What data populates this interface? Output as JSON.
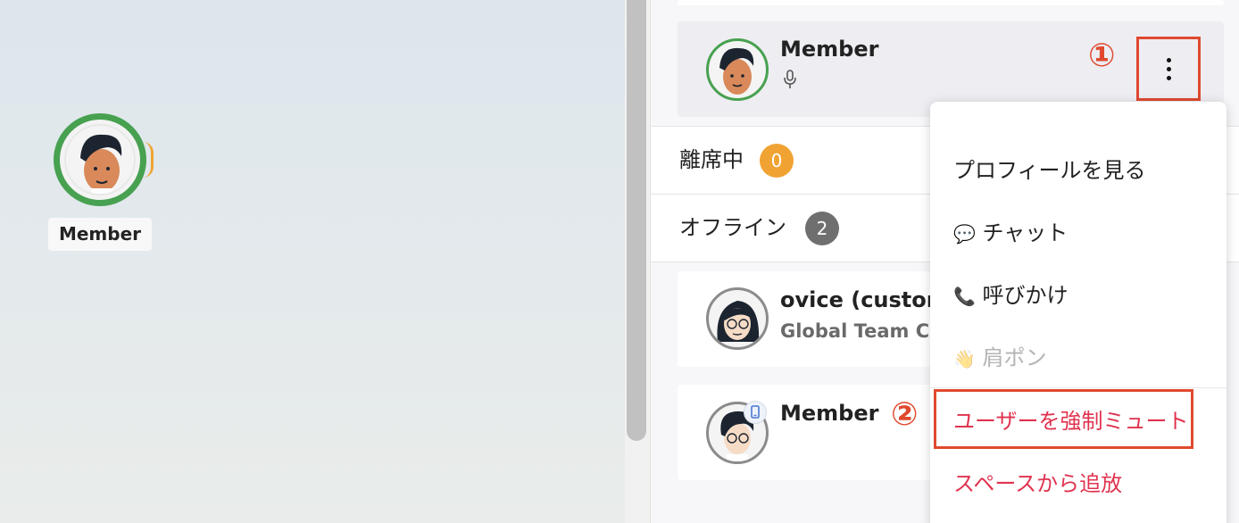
{
  "canvas": {
    "avatar_label": "Member"
  },
  "panel": {
    "active_member": {
      "name": "Member",
      "mic_icon": "microphone-icon"
    },
    "away_section": {
      "label": "離席中",
      "count": "0",
      "badge_color": "#f0a332"
    },
    "offline_section": {
      "label": "オフライン",
      "count": "2",
      "badge_color": "#6f6f6f"
    },
    "offline_members": [
      {
        "name": "ovice (custom",
        "subtitle": "Global Team Cus"
      },
      {
        "name": "Member"
      }
    ]
  },
  "context_menu": {
    "items": [
      {
        "label": "プロフィールを見る",
        "icon": ""
      },
      {
        "label": "チャット",
        "icon": "💬"
      },
      {
        "label": "呼びかけ",
        "icon": "📞"
      },
      {
        "label": "肩ポン",
        "icon": "👋",
        "disabled": true
      },
      {
        "label": "ユーザーを強制ミュート",
        "danger": true
      },
      {
        "label": "スペースから追放",
        "danger": true
      }
    ]
  },
  "annotations": {
    "step1": "①",
    "step2": "②",
    "color": "#e0492f"
  }
}
